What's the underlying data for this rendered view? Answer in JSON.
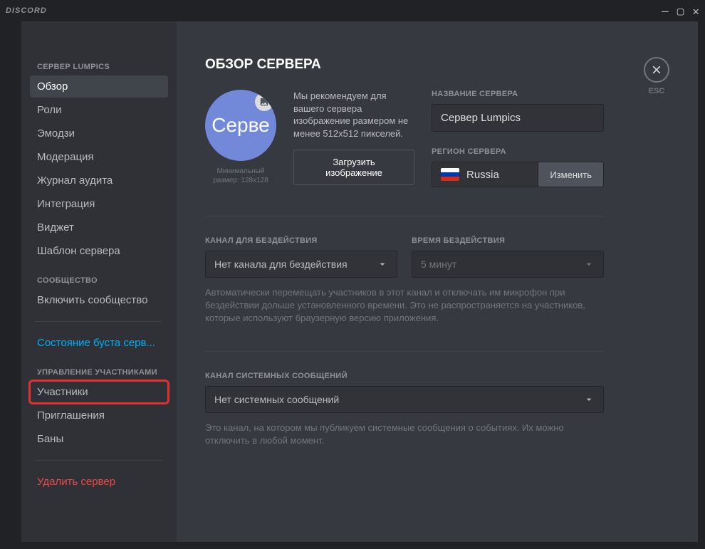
{
  "titlebar": {
    "brand": "DISCORD"
  },
  "sidebar": {
    "server_header": "СЕРВЕР LUMPICS",
    "community_header": "СООБЩЕСТВО",
    "user_mgmt_header": "УПРАВЛЕНИЕ УЧАСТНИКАМИ",
    "items": {
      "overview": "Обзор",
      "roles": "Роли",
      "emoji": "Эмодзи",
      "moderation": "Модерация",
      "audit_log": "Журнал аудита",
      "integration": "Интеграция",
      "widget": "Виджет",
      "template": "Шаблон сервера",
      "enable_community": "Включить сообщество",
      "boost_status": "Состояние буста серв...",
      "members": "Участники",
      "invites": "Приглашения",
      "bans": "Баны",
      "delete_server": "Удалить сервер"
    }
  },
  "content": {
    "close_label": "ESC",
    "title": "ОБЗОР СЕРВЕРА",
    "avatar_text": "Серве",
    "avatar_caption": "Минимальный размер: 128x128",
    "recommend_text": "Мы рекомендуем для вашего сервера изображение размером не менее 512x512 пикселей.",
    "upload_btn": "Загрузить изображение",
    "name_label": "НАЗВАНИЕ СЕРВЕРА",
    "name_value": "Сервер Lumpics",
    "region_label": "РЕГИОН СЕРВЕРА",
    "region_value": "Russia",
    "region_change": "Изменить",
    "afk_channel_label": "КАНАЛ ДЛЯ БЕЗДЕЙСТВИЯ",
    "afk_channel_value": "Нет канала для бездействия",
    "afk_timeout_label": "ВРЕМЯ БЕЗДЕЙСТВИЯ",
    "afk_timeout_value": "5 минут",
    "afk_help": "Автоматически перемещать участников в этот канал и отключать им микрофон при бездействии дольше установленного времени. Это не распространяется на участников, которые используют браузерную версию приложения.",
    "system_channel_label": "КАНАЛ СИСТЕМНЫХ СООБЩЕНИЙ",
    "system_channel_value": "Нет системных сообщений",
    "system_help": "Это канал, на котором мы публикуем системные сообщения о событиях. Их можно отключить в любой момент."
  }
}
